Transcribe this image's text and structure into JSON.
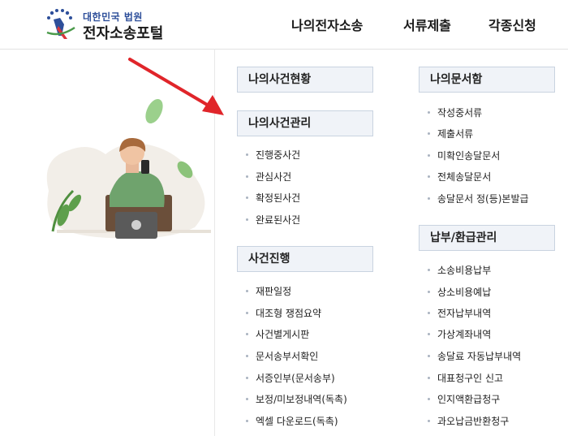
{
  "header": {
    "logo_sub": "대한민국 법원",
    "logo_main": "전자소송포털",
    "nav": [
      "나의전자소송",
      "서류제출",
      "각종신청"
    ]
  },
  "menu": {
    "left": {
      "sec1": {
        "title": "나의사건현황"
      },
      "sec2": {
        "title": "나의사건관리",
        "items": [
          "진행중사건",
          "관심사건",
          "확정된사건",
          "완료된사건"
        ]
      },
      "sec3": {
        "title": "사건진행",
        "items": [
          "재판일정",
          "대조형 쟁점요약",
          "사건별게시판",
          "문서송부서확인",
          "서증인부(문서송부)",
          "보정/미보정내역(독촉)",
          "엑셀 다운로드(독촉)"
        ]
      }
    },
    "right": {
      "sec1": {
        "title": "나의문서함",
        "items": [
          "작성중서류",
          "제출서류",
          "미확인송달문서",
          "전체송달문서",
          "송달문서 정(등)본발급"
        ]
      },
      "sec2": {
        "title": "납부/환급관리",
        "items": [
          "소송비용납부",
          "상소비용예납",
          "전자납부내역",
          "가상계좌내역",
          "송달료 자동납부내역",
          "대표청구인 신고",
          "인지액환급청구",
          "과오납금반환청구"
        ]
      }
    }
  },
  "colors": {
    "arrow": "#e0252a",
    "section_bg": "#f0f3f8",
    "section_border": "#c9d3e0",
    "brand": "#2e4f9a"
  }
}
